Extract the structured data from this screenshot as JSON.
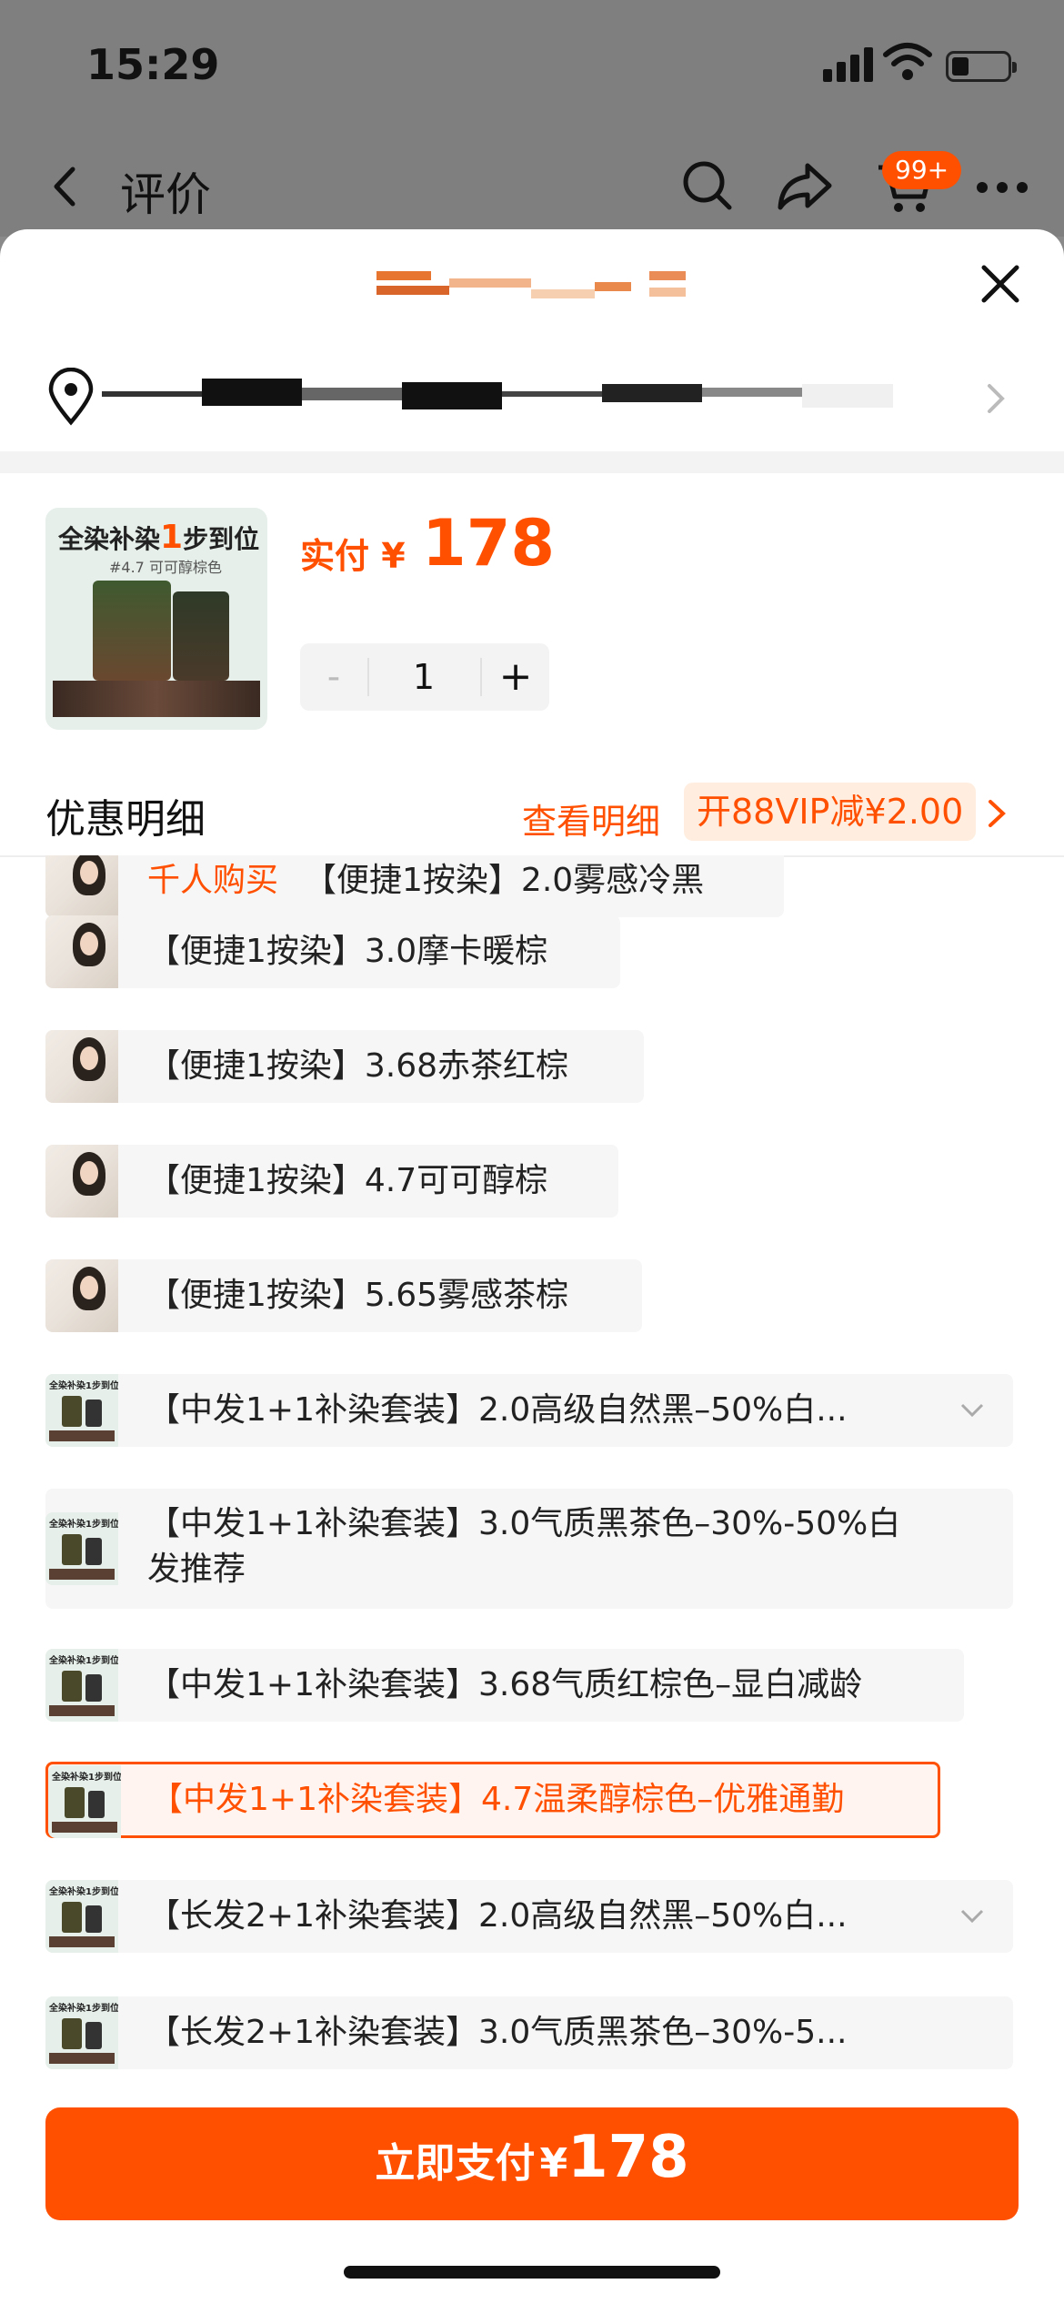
{
  "status": {
    "time": "15:29"
  },
  "nav": {
    "title": "评价",
    "cart_badge": "99+"
  },
  "product": {
    "thumb_title_a": "全染补染",
    "thumb_title_num": "1",
    "thumb_title_b": "步到位",
    "thumb_subtitle": "#4.7 可可醇棕色",
    "price_label": "实付 ¥",
    "price_value": "178",
    "quantity": "1",
    "minus_label": "-",
    "plus_label": "+"
  },
  "discount": {
    "title": "优惠明细",
    "view_label": "查看明细",
    "vip_label": "开88VIP减¥2.00"
  },
  "variants": [
    {
      "hot_text": "千人购买",
      "label": "【便捷1按染】2.0雾感冷黑"
    },
    {
      "label": "【便捷1按染】3.0摩卡暖棕"
    },
    {
      "label": "【便捷1按染】3.68赤茶红棕"
    },
    {
      "label": "【便捷1按染】4.7可可醇棕"
    },
    {
      "label": "【便捷1按染】5.65雾感茶棕"
    },
    {
      "label": "【中发1+1补染套装】2.0高级自然黑–50%白..."
    },
    {
      "label": "【中发1+1补染套装】3.0气质黑茶色–30%-50%白",
      "label_line2": "发推荐"
    },
    {
      "label": "【中发1+1补染套装】3.68气质红棕色–显白减龄"
    },
    {
      "label": "【中发1+1补染套装】4.7温柔醇棕色–优雅通勤"
    },
    {
      "label": "【长发2+1补染套装】2.0高级自然黑–50%白..."
    },
    {
      "label": "【长发2+1补染套装】3.0气质黑茶色–30%-5..."
    }
  ],
  "kit_thumb_text": "全染补染1步到位",
  "pay": {
    "label": "立即支付",
    "currency": "¥",
    "price": "178"
  },
  "colors": {
    "accent": "#ff5000",
    "sheet_bg": "#ffffff",
    "overlay": "#7f7f7f"
  }
}
